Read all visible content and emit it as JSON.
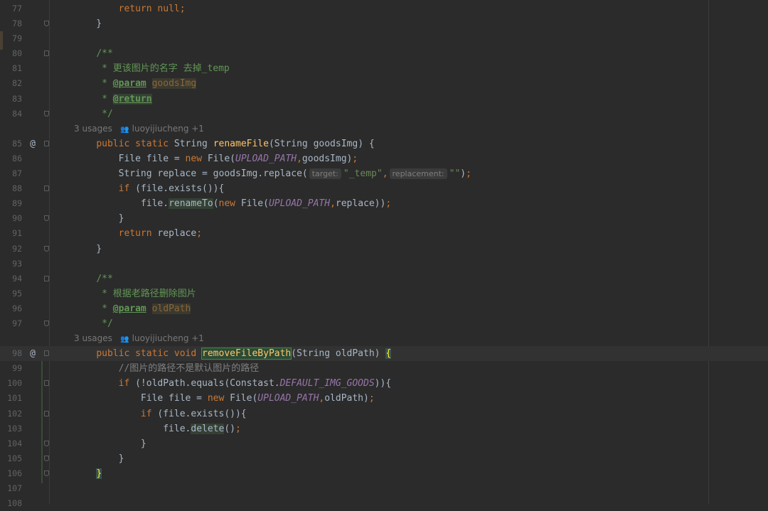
{
  "lines": [
    {
      "n": "77",
      "segs": [
        {
          "t": "        "
        },
        {
          "t": "return null",
          "c": "k"
        },
        {
          "t": ";",
          "c": "k"
        }
      ]
    },
    {
      "n": "78",
      "fold": "end",
      "segs": [
        {
          "t": "    }"
        }
      ]
    },
    {
      "n": "79",
      "segs": []
    },
    {
      "n": "80",
      "fold": "start",
      "segs": [
        {
          "t": "    "
        },
        {
          "t": "/**",
          "c": "c"
        }
      ]
    },
    {
      "n": "81",
      "segs": [
        {
          "t": "     * 更该图片的名字 去掉",
          "c": "c"
        },
        {
          "t": "_temp",
          "c": "c"
        }
      ]
    },
    {
      "n": "82",
      "segs": [
        {
          "t": "     * ",
          "c": "c"
        },
        {
          "t": "@param",
          "c": "tag"
        },
        {
          "t": " ",
          "c": "c"
        },
        {
          "t": "goodsImg",
          "c": "pname"
        }
      ]
    },
    {
      "n": "83",
      "segs": [
        {
          "t": "     * ",
          "c": "c"
        },
        {
          "t": "@return",
          "c": "tag hl"
        }
      ]
    },
    {
      "n": "84",
      "fold": "end",
      "segs": [
        {
          "t": "     */",
          "c": "c"
        }
      ]
    },
    {
      "hint": true,
      "usages": "3 usages",
      "author": "luoyijiucheng +1"
    },
    {
      "n": "85",
      "ann": "@",
      "fold": "start",
      "segs": [
        {
          "t": "    "
        },
        {
          "t": "public static ",
          "c": "k"
        },
        {
          "t": "String "
        },
        {
          "t": "renameFile",
          "c": "m"
        },
        {
          "t": "(String goodsImg) {"
        }
      ]
    },
    {
      "n": "86",
      "segs": [
        {
          "t": "        File file = "
        },
        {
          "t": "new ",
          "c": "k"
        },
        {
          "t": "File("
        },
        {
          "t": "UPLOAD_PATH",
          "c": "f"
        },
        {
          "t": ",",
          "c": "k"
        },
        {
          "t": "goodsImg)"
        },
        {
          "t": ";",
          "c": "k"
        }
      ]
    },
    {
      "n": "87",
      "segs": [
        {
          "t": "        String replace = goodsImg.replace("
        },
        {
          "inlay": "target:"
        },
        {
          "t": "\"_temp\"",
          "c": "s"
        },
        {
          "t": ",",
          "c": "k"
        },
        {
          "inlay": "replacement:"
        },
        {
          "t": "\"\"",
          "c": "s"
        },
        {
          "t": ")"
        },
        {
          "t": ";",
          "c": "k"
        }
      ]
    },
    {
      "n": "88",
      "fold": "start",
      "segs": [
        {
          "t": "        "
        },
        {
          "t": "if ",
          "c": "k"
        },
        {
          "t": "(file.exists()){"
        }
      ]
    },
    {
      "n": "89",
      "segs": [
        {
          "t": "            file."
        },
        {
          "t": "renameTo",
          "c": "usage"
        },
        {
          "t": "("
        },
        {
          "t": "new ",
          "c": "k"
        },
        {
          "t": "File("
        },
        {
          "t": "UPLOAD_PATH",
          "c": "f"
        },
        {
          "t": ",",
          "c": "k"
        },
        {
          "t": "replace))"
        },
        {
          "t": ";",
          "c": "k"
        }
      ]
    },
    {
      "n": "90",
      "fold": "end",
      "segs": [
        {
          "t": "        }"
        }
      ]
    },
    {
      "n": "91",
      "segs": [
        {
          "t": "        "
        },
        {
          "t": "return ",
          "c": "k"
        },
        {
          "t": "replace"
        },
        {
          "t": ";",
          "c": "k"
        }
      ]
    },
    {
      "n": "92",
      "fold": "end",
      "segs": [
        {
          "t": "    }"
        }
      ]
    },
    {
      "n": "93",
      "segs": []
    },
    {
      "n": "94",
      "fold": "start",
      "segs": [
        {
          "t": "    "
        },
        {
          "t": "/**",
          "c": "c"
        }
      ]
    },
    {
      "n": "95",
      "segs": [
        {
          "t": "     * 根据老路径删除图片",
          "c": "c"
        }
      ]
    },
    {
      "n": "96",
      "segs": [
        {
          "t": "     * ",
          "c": "c"
        },
        {
          "t": "@param",
          "c": "tag"
        },
        {
          "t": " ",
          "c": "c"
        },
        {
          "t": "oldPath",
          "c": "pname"
        }
      ]
    },
    {
      "n": "97",
      "fold": "end",
      "segs": [
        {
          "t": "     */",
          "c": "c"
        }
      ]
    },
    {
      "hint": true,
      "usages": "3 usages",
      "author": "luoyijiucheng +1"
    },
    {
      "n": "98",
      "ann": "@",
      "fold": "start",
      "current": true,
      "segs": [
        {
          "t": "    "
        },
        {
          "t": "public static void ",
          "c": "k"
        },
        {
          "t": "removeFileByPath",
          "c": "m box"
        },
        {
          "t": "(String oldPath) "
        },
        {
          "t": "{",
          "c": "brace"
        }
      ]
    },
    {
      "n": "99",
      "segs": [
        {
          "t": "        "
        },
        {
          "t": "//图片的路径不是默认图片的路径",
          "c": "cmt"
        }
      ]
    },
    {
      "n": "100",
      "fold": "start",
      "segs": [
        {
          "t": "        "
        },
        {
          "t": "if ",
          "c": "k"
        },
        {
          "t": "(!oldPath.equals(Constast."
        },
        {
          "t": "DEFAULT_IMG_GOODS",
          "c": "f"
        },
        {
          "t": ")){"
        }
      ]
    },
    {
      "n": "101",
      "segs": [
        {
          "t": "            File file = "
        },
        {
          "t": "new ",
          "c": "k"
        },
        {
          "t": "File("
        },
        {
          "t": "UPLOAD_PATH",
          "c": "f"
        },
        {
          "t": ",",
          "c": "k"
        },
        {
          "t": "oldPath)"
        },
        {
          "t": ";",
          "c": "k"
        }
      ]
    },
    {
      "n": "102",
      "fold": "start",
      "segs": [
        {
          "t": "            "
        },
        {
          "t": "if ",
          "c": "k"
        },
        {
          "t": "(file.exists()){"
        }
      ]
    },
    {
      "n": "103",
      "segs": [
        {
          "t": "                file."
        },
        {
          "t": "delete",
          "c": "usage"
        },
        {
          "t": "()"
        },
        {
          "t": ";",
          "c": "k"
        }
      ]
    },
    {
      "n": "104",
      "fold": "end",
      "segs": [
        {
          "t": "            }"
        }
      ]
    },
    {
      "n": "105",
      "fold": "end",
      "segs": [
        {
          "t": "        }"
        }
      ]
    },
    {
      "n": "106",
      "fold": "end",
      "segs": [
        {
          "t": "    "
        },
        {
          "t": "}",
          "c": "brace"
        }
      ]
    },
    {
      "n": "107",
      "segs": []
    },
    {
      "n": "108",
      "segs": []
    }
  ],
  "colors": {
    "background": "#2b2b2b",
    "keyword": "#cc7832",
    "method": "#ffc66d",
    "doc": "#629755",
    "string": "#6a8759",
    "field": "#9876aa"
  }
}
